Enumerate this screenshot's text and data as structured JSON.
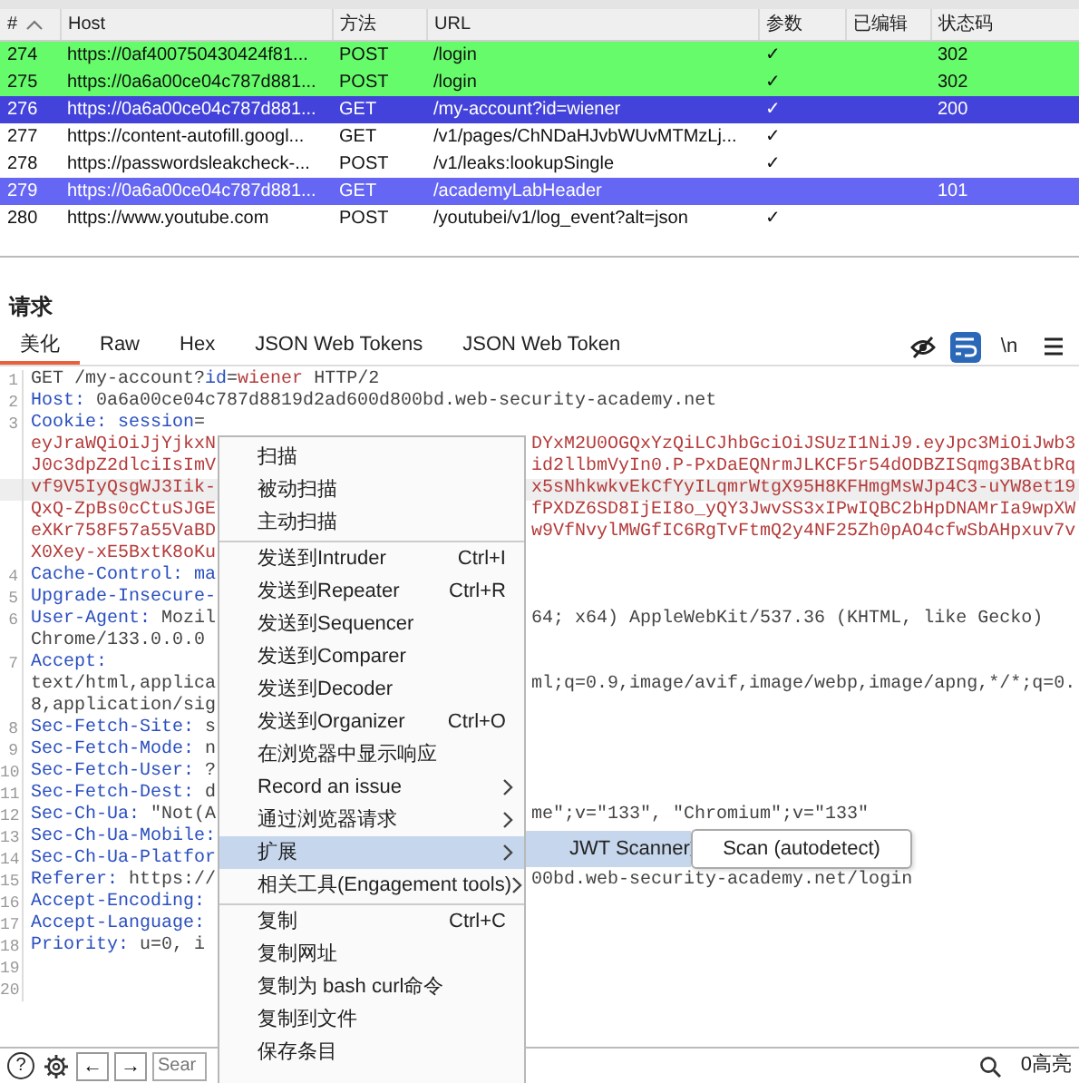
{
  "history_table": {
    "columns": [
      {
        "label": "#",
        "sorted": true
      },
      {
        "label": "Host",
        "sorted": false
      },
      {
        "label": "方法",
        "sorted": false
      },
      {
        "label": "URL",
        "sorted": false
      },
      {
        "label": "参数",
        "sorted": false
      },
      {
        "label": "已编辑",
        "sorted": false
      },
      {
        "label": "状态码",
        "sorted": false
      }
    ],
    "rows": [
      {
        "number": "274",
        "host": "https://0af400750430424f81...",
        "method": "POST",
        "url": "/login",
        "params": "✓",
        "status": "302",
        "selected": false,
        "color": "#66fb6a"
      },
      {
        "number": "275",
        "host": "https://0a6a00ce04c787d881...",
        "method": "POST",
        "url": "/login",
        "params": "✓",
        "status": "302",
        "selected": false,
        "color": "#66fb6a"
      },
      {
        "number": "276",
        "host": "https://0a6a00ce04c787d881...",
        "method": "GET",
        "url": "/my-account?id=wiener",
        "params": "✓",
        "status": "200",
        "selected": true
      },
      {
        "number": "277",
        "host": "https://content-autofill.googl...",
        "method": "GET",
        "url": "/v1/pages/ChNDaHJvbWUvMTMzLj...",
        "params": "✓",
        "selected": false
      },
      {
        "number": "278",
        "host": "https://passwordsleakcheck-...",
        "method": "POST",
        "url": "/v1/leaks:lookupSingle",
        "params": "✓",
        "selected": false
      },
      {
        "number": "279",
        "host": "https://0a6a00ce04c787d881...",
        "method": "GET",
        "url": "/academyLabHeader",
        "status": "101",
        "selected": false,
        "color": "#6666f4"
      },
      {
        "number": "280",
        "host": "https://www.youtube.com",
        "method": "POST",
        "url": "/youtubei/v1/log_event?alt=json",
        "params": "✓",
        "selected": false
      }
    ]
  },
  "request": {
    "title": "请求",
    "tabs": [
      {
        "label": "美化",
        "selected": true
      },
      {
        "label": "Raw",
        "selected": false
      },
      {
        "label": "Hex",
        "selected": false
      },
      {
        "label": "JSON Web Tokens",
        "selected": false
      },
      {
        "label": "JSON Web Token",
        "selected": false
      }
    ],
    "tools": [
      {
        "kind": "hide",
        "on": false
      },
      {
        "kind": "wrap",
        "on": true
      },
      {
        "kind": "text",
        "label": "\\n",
        "on": false
      },
      {
        "kind": "menu",
        "on": false
      }
    ],
    "lines": [
      {
        "number": "1",
        "highlighted": false,
        "left": [
          {
            "kind": "plain",
            "text": "GET /my-account?"
          },
          {
            "kind": "name",
            "text": "id"
          },
          {
            "kind": "plain",
            "text": "="
          },
          {
            "kind": "value",
            "text": "wiener"
          },
          {
            "kind": "plain",
            "text": " HTTP/2"
          }
        ]
      },
      {
        "number": "2",
        "highlighted": false,
        "left": [
          {
            "kind": "name",
            "text": "Host:"
          },
          {
            "kind": "plain",
            "text": " 0a6a00ce04c787d8819d2ad600d800bd.web-security-academy.net"
          }
        ]
      },
      {
        "number": "3",
        "highlighted": false,
        "left": [
          {
            "kind": "name",
            "text": "Cookie: session"
          },
          {
            "kind": "plain",
            "text": "="
          }
        ]
      },
      {
        "highlighted": false,
        "left": [
          {
            "kind": "value",
            "text": "eyJraWQiOiJjYjkxN"
          }
        ],
        "right": {
          "kind": "value",
          "text": "DYxM2U0OGQxYzQiLCJhbGciOiJSUzI1NiJ9.eyJpc3MiOiJwb3"
        }
      },
      {
        "highlighted": false,
        "left": [
          {
            "kind": "value",
            "text": "J0c3dpZ2dlciIsImV"
          }
        ],
        "right": {
          "kind": "value",
          "text": "id2llbmVyIn0.P-PxDaEQNrmJLKCF5r54dODBZISqmg3BAtbRq"
        }
      },
      {
        "highlighted": true,
        "left": [
          {
            "kind": "value",
            "text": "vf9V5IyQsgWJ3Iik-"
          }
        ],
        "right": {
          "kind": "value",
          "text": "x5sNhkwkvEkCfYyILqmrWtgX95H8KFHmgMsWJp4C3-uYW8et19"
        }
      },
      {
        "highlighted": false,
        "left": [
          {
            "kind": "value",
            "text": "QxQ-ZpBs0cCtuSJGE"
          }
        ],
        "right": {
          "kind": "value",
          "text": "fPXDZ6SD8IjEI8o_yQY3JwvSS3xIPwIQBC2bHpDNAMrIa9wpXW"
        }
      },
      {
        "highlighted": false,
        "left": [
          {
            "kind": "value",
            "text": "eXKr758F57a55VaBD"
          }
        ],
        "right": {
          "kind": "value",
          "text": "w9VfNvylMWGfIC6RgTvFtmQ2y4NF25Zh0pAO4cfwSbAHpxuv7v"
        }
      },
      {
        "highlighted": false,
        "left": [
          {
            "kind": "value",
            "text": "X0Xey-xE5BxtK8oKu"
          }
        ]
      },
      {
        "number": "4",
        "highlighted": false,
        "left": [
          {
            "kind": "name",
            "text": "Cache-Control: ma"
          }
        ]
      },
      {
        "number": "5",
        "highlighted": false,
        "left": [
          {
            "kind": "name",
            "text": "Upgrade-Insecure-"
          }
        ]
      },
      {
        "number": "6",
        "highlighted": false,
        "left": [
          {
            "kind": "name",
            "text": "User-Agent:"
          },
          {
            "kind": "plain",
            "text": " Mozil"
          }
        ],
        "right": {
          "kind": "plain",
          "text": "64; x64) AppleWebKit/537.36 (KHTML, like Gecko)"
        }
      },
      {
        "highlighted": false,
        "left": [
          {
            "kind": "plain",
            "text": "Chrome/133.0.0.0"
          }
        ]
      },
      {
        "number": "7",
        "highlighted": false,
        "left": [
          {
            "kind": "name",
            "text": "Accept:"
          }
        ]
      },
      {
        "highlighted": false,
        "left": [
          {
            "kind": "plain",
            "text": "text/html,applica"
          }
        ],
        "right": {
          "kind": "plain",
          "text": "ml;q=0.9,image/avif,image/webp,image/apng,*/*;q=0."
        }
      },
      {
        "highlighted": false,
        "left": [
          {
            "kind": "plain",
            "text": "8,application/sig"
          }
        ]
      },
      {
        "number": "8",
        "highlighted": false,
        "left": [
          {
            "kind": "name",
            "text": "Sec-Fetch-Site:"
          },
          {
            "kind": "plain",
            "text": " s"
          }
        ]
      },
      {
        "number": "9",
        "highlighted": false,
        "left": [
          {
            "kind": "name",
            "text": "Sec-Fetch-Mode:"
          },
          {
            "kind": "plain",
            "text": " n"
          }
        ]
      },
      {
        "number": "10",
        "highlighted": false,
        "left": [
          {
            "kind": "name",
            "text": "Sec-Fetch-User:"
          },
          {
            "kind": "plain",
            "text": " ?"
          }
        ]
      },
      {
        "number": "11",
        "highlighted": false,
        "left": [
          {
            "kind": "name",
            "text": "Sec-Fetch-Dest:"
          },
          {
            "kind": "plain",
            "text": " d"
          }
        ]
      },
      {
        "number": "12",
        "highlighted": false,
        "left": [
          {
            "kind": "name",
            "text": "Sec-Ch-Ua:"
          },
          {
            "kind": "plain",
            "text": " \"Not(A"
          }
        ],
        "right": {
          "kind": "plain",
          "text": "me\";v=\"133\", \"Chromium\";v=\"133\""
        }
      },
      {
        "number": "13",
        "highlighted": false,
        "left": [
          {
            "kind": "name",
            "text": "Sec-Ch-Ua-Mobile:"
          }
        ]
      },
      {
        "number": "14",
        "highlighted": false,
        "left": [
          {
            "kind": "name",
            "text": "Sec-Ch-Ua-Platfor"
          }
        ]
      },
      {
        "number": "15",
        "highlighted": false,
        "left": [
          {
            "kind": "name",
            "text": "Referer:"
          },
          {
            "kind": "plain",
            "text": " https://"
          }
        ],
        "right": {
          "kind": "plain",
          "text": "00bd.web-security-academy.net/login"
        }
      },
      {
        "number": "16",
        "highlighted": false,
        "left": [
          {
            "kind": "name",
            "text": "Accept-Encoding:"
          }
        ]
      },
      {
        "number": "17",
        "highlighted": false,
        "left": [
          {
            "kind": "name",
            "text": "Accept-Language:"
          }
        ]
      },
      {
        "number": "18",
        "highlighted": false,
        "left": [
          {
            "kind": "name",
            "text": "Priority:"
          },
          {
            "kind": "plain",
            "text": " u=0, i"
          }
        ]
      },
      {
        "number": "19",
        "highlighted": false
      },
      {
        "number": "20",
        "highlighted": false
      }
    ]
  },
  "bottom_bar": {
    "help": "?",
    "back": "←",
    "forward": "→",
    "search": {
      "placeholder": "Sear"
    },
    "highlights": "0高亮"
  },
  "context_menu": {
    "items": [
      {
        "kind": "item",
        "label": "扫描",
        "selected": false
      },
      {
        "kind": "item",
        "label": "被动扫描",
        "selected": false
      },
      {
        "kind": "item",
        "label": "主动扫描",
        "selected": false
      },
      {
        "kind": "divider"
      },
      {
        "kind": "item",
        "label": "发送到Intruder",
        "shortcut": "Ctrl+I",
        "selected": false
      },
      {
        "kind": "item",
        "label": "发送到Repeater",
        "shortcut": "Ctrl+R",
        "selected": false
      },
      {
        "kind": "item",
        "label": "发送到Sequencer",
        "selected": false
      },
      {
        "kind": "item",
        "label": "发送到Comparer",
        "selected": false
      },
      {
        "kind": "item",
        "label": "发送到Decoder",
        "selected": false
      },
      {
        "kind": "item",
        "label": "发送到Organizer",
        "shortcut": "Ctrl+O",
        "selected": false
      },
      {
        "kind": "item",
        "label": "在浏览器中显示响应",
        "selected": false
      },
      {
        "kind": "item",
        "label": "Record an issue",
        "submenu": true,
        "selected": false
      },
      {
        "kind": "item",
        "label": "通过浏览器请求",
        "submenu": true,
        "selected": false
      },
      {
        "kind": "item",
        "label": "扩展",
        "submenu": true,
        "selected": true
      },
      {
        "kind": "item",
        "label": "相关工具(Engagement tools)",
        "submenu": true,
        "selected": false
      },
      {
        "kind": "divider"
      },
      {
        "kind": "item",
        "label": "复制",
        "shortcut": "Ctrl+C",
        "selected": false
      },
      {
        "kind": "item",
        "label": "复制网址",
        "selected": false
      },
      {
        "kind": "item",
        "label": "复制为 bash curl命令",
        "selected": false
      },
      {
        "kind": "item",
        "label": "复制到文件",
        "selected": false
      },
      {
        "kind": "item",
        "label": "保存条目",
        "selected": false
      }
    ]
  },
  "extensions_menu": {
    "items": [
      {
        "label": "JWT Scanner",
        "submenu": true,
        "selected": true
      }
    ]
  },
  "jwt_scanner_menu": {
    "items": [
      {
        "label": "Scan (autodetect)",
        "selected": false
      }
    ]
  }
}
